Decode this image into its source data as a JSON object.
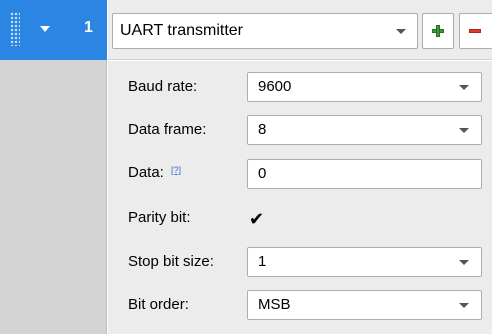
{
  "row": {
    "index": "1"
  },
  "header": {
    "selected_block": "UART transmitter"
  },
  "fields": {
    "baud_rate": {
      "label": "Baud rate:",
      "value": "9600"
    },
    "data_frame": {
      "label": "Data frame:",
      "value": "8"
    },
    "data": {
      "label": "Data:",
      "help": "[?]",
      "value": "0"
    },
    "parity_bit": {
      "label": "Parity bit:",
      "check_glyph": "✔",
      "checked": true
    },
    "stop_bit_size": {
      "label": "Stop bit size:",
      "value": "1"
    },
    "bit_order": {
      "label": "Bit order:",
      "value": "MSB"
    }
  },
  "colors": {
    "selection": "#2b86e3",
    "panel": "#ececec",
    "left_band": "#d4d4d4",
    "add": "#3a9a35",
    "remove": "#e23b2a"
  },
  "icons": [
    "drag-grip-icon",
    "collapse-arrow-icon",
    "chevron-down-icon",
    "plus-icon",
    "minus-icon",
    "help-icon",
    "checkmark-icon"
  ]
}
